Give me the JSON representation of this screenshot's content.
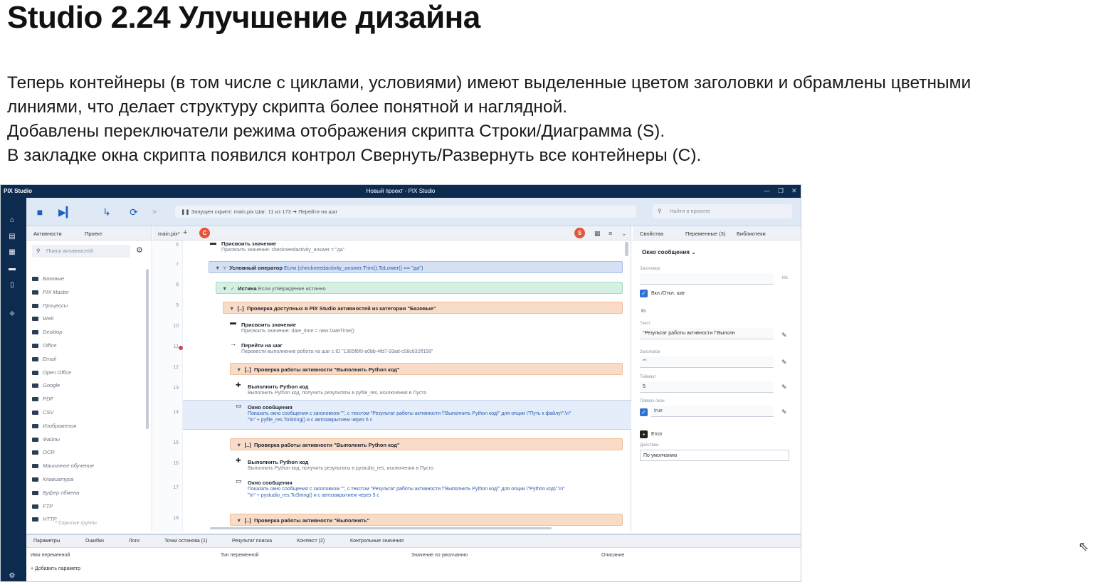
{
  "slide": {
    "title": "Studio 2.24 Улучшение дизайна",
    "lines": [
      "Теперь контейнеры (в том числе с циклами, условиями) имеют выделенные цветом заголовки и обрамлены цветными",
      "линиями, что делает структуру скрипта более понятной и наглядной.",
      "Добавлены переключатели режима отображения скрипта Строки/Диаграмма (S).",
      "В закладке окна скрипта появился контрол Свернуть/Развернуть все контейнеры (С)."
    ]
  },
  "window": {
    "app_name": "PIX Studio",
    "title": "Новый проект - PIX Studio",
    "min": "—",
    "max": "❐",
    "close": "✕"
  },
  "toolbar": {
    "stop": "■",
    "step": "▶▎",
    "step_into": "↳",
    "loop": "⟳",
    "more": "»",
    "run_status": "❚❚  Запущен скрипт: main.pix   Шаг: 11 из 173   ➜ Перейти на шаг",
    "search_placeholder": "Найти в проекте",
    "search_icon": "⚲"
  },
  "left_panel": {
    "tabs": [
      "Активности",
      "Проект"
    ],
    "search_placeholder": "Поиск активностей",
    "categories": [
      "Базовые",
      "PIX Master",
      "Процессы",
      "Web",
      "Desktop",
      "Office",
      "Email",
      "Open Office",
      "Google",
      "PDF",
      "CSV",
      "Изображения",
      "Файлы",
      "OCR",
      "Машинное обучение",
      "Клавиатура",
      "Буфер обмена",
      "FTP",
      "HTTP"
    ],
    "hidden_groups": "^ Скрытые группы"
  },
  "editor": {
    "tab": "main.pix*",
    "plus": "+",
    "badge_c": "C",
    "badge_s": "S",
    "line_numbers": [
      "6",
      "7",
      "8",
      "9",
      "10",
      "11",
      "12",
      "13",
      "14",
      "15",
      "16",
      "17",
      "18"
    ],
    "assign_title": "Присвоить значение",
    "assign_desc": "Присвоить значение: checkneedactivity_answer = \"да\"",
    "if_title": "Условный оператор",
    "if_desc": "Если (checkneedactivity_answer.Trim().ToLower() == \"да\")",
    "true_title": "Истина",
    "true_desc": "Если утверждение истинно",
    "container1": "Проверка доступных в PIX Studio активностей из категории \"Базовые\"",
    "assign2_title": "Присвоить значение",
    "assign2_desc": "Присвоить значение: date_time = new DateTime()",
    "goto_title": "Перейти на шаг",
    "goto_desc": "Перевести выполнение робота на шаг с ID \"1365f6f9-a0bb-4fd7-93ad-c08c832ff158\"",
    "container2": "Проверка работы активности \"Выполнить Python код\"",
    "python_title": "Выполнить Python код",
    "python_desc": "Выполнить Python код, получить результаты в pyfile_res, исключения в Пусто",
    "msg_title": "Окно сообщения",
    "msg_desc1": "Показать окно сообщения с заголовком \"\", с текстом \"Результат работы активности \\\"Выполнить Python код\\\" для опции \\\"Путь к файлу\\\":\\n\"",
    "msg_desc2": "\"\\n\" + pyfile_res.ToString() и с автозакрытием через 5 с",
    "container3": "Проверка работы активности \"Выполнить Python код\"",
    "python2_title": "Выполнить Python код",
    "python2_desc": "Выполнить Python код, получить результаты в pystudio_res, исключения в Пусто",
    "msg2_title": "Окно сообщения",
    "msg2_desc1": "Показать окно сообщения с заголовком \"\", с текстом \"Результат работы активности \\\"Выполнить Python код\\\" для опции \\\"Python код\\\":\\n\"",
    "msg2_desc2": "\"\\n\" + pystudio_res.ToString() и с автозакрытием через 5 с",
    "container4": "Проверка работы активности \"Выполнить\""
  },
  "right_panel": {
    "tabs": [
      "Свойства",
      "Переменные (3)",
      "Библиотеки"
    ],
    "title": "Окно сообщения ⌄",
    "label_header": "Заголовок",
    "ms": "Мс",
    "enable_step": "Вкл./Откл. шаг",
    "in_label": "In",
    "label_text": "Текст",
    "text_value": "\"Результат работы активности \\\"Выполн",
    "label_caption": "Заголовок",
    "caption_value": "\"\"",
    "label_timeout": "Таймаут",
    "timeout_value": "5",
    "label_topmost": "Поверх окон",
    "topmost_value": "true",
    "error_label": "Error",
    "label_action": "Действие",
    "action_value": "По умолчанию"
  },
  "bottom_panel": {
    "tabs": [
      "Параметры",
      "Ошибки",
      "Логи",
      "Точки останова (1)",
      "Результат поиска",
      "Контекст (2)",
      "Контрольные значения"
    ],
    "columns": [
      "Имя переменной",
      "Тип переменной",
      "Значение по умолчанию",
      "Описание"
    ],
    "add_param": "+ Добавить параметр"
  },
  "colors": {
    "blue_header": "#d5e0f4",
    "green_header": "#d5f0e2",
    "orange_header": "#f9dcc8",
    "rail": "#0d2a4f",
    "badge": "#e5533c"
  }
}
